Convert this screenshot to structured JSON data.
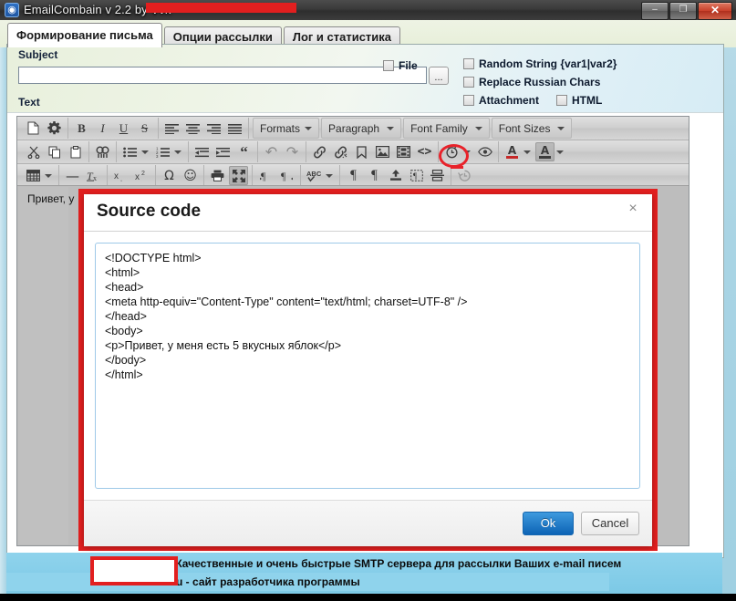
{
  "window": {
    "title": "EmailCombain v 2.2 by Vvk",
    "icon": "app-globe-icon",
    "minimize": "–",
    "maximize": "❐",
    "close": "✕"
  },
  "tabs": [
    {
      "label": "Формирование письма",
      "active": true
    },
    {
      "label": "Опции рассылки",
      "active": false
    },
    {
      "label": "Лог и статистика",
      "active": false
    }
  ],
  "form": {
    "subject_label": "Subject",
    "subject_value": "",
    "subject_placeholder": "",
    "browse_label": "...",
    "text_label": "Text",
    "checkboxes": {
      "file": "File",
      "random_string": "Random String {var1|var2}",
      "replace_russian": "Replace Russian Chars",
      "attachment": "Attachment",
      "html": "HTML"
    }
  },
  "toolbar": {
    "row1": {
      "new_document": "⬚",
      "settings": "⚙",
      "bold": "B",
      "italic": "I",
      "underline": "U",
      "strikethrough": "S",
      "align_left": "align-left",
      "align_center": "align-center",
      "align_right": "align-right",
      "align_justify": "align-justify",
      "formats": "Formats",
      "paragraph": "Paragraph",
      "font_family": "Font Family",
      "font_sizes": "Font Sizes"
    },
    "row2": {
      "cut": "✂",
      "copy": "copy",
      "paste": "paste",
      "find_replace": "find",
      "bullist": "bullist",
      "numlist": "numlist",
      "outdent": "outdent",
      "indent": "indent",
      "blockquote": "“",
      "undo": "↶",
      "redo": "↷",
      "link": "link",
      "unlink": "unlink",
      "anchor": "anchor",
      "image": "image",
      "media": "media",
      "source_code": "<>",
      "insert_datetime": "clock",
      "preview": "eye",
      "text_color": "A",
      "background_color": "A"
    },
    "row3": {
      "table": "table",
      "horizontal_rule": "—",
      "remove_format": "Tx",
      "subscript": "x₂",
      "superscript": "x²",
      "special_char": "Ω",
      "emoticons": "☺",
      "print": "print",
      "fullscreen": "fullscreen",
      "ltr": "ltr",
      "rtl": "rtl",
      "spellcheck": "ABC",
      "show_blocks": "¶",
      "visual_blocks": "¶",
      "insert_file": "upload",
      "visual_chars": "visualchars",
      "page_break": "pagebreak",
      "restore_draft": "restoredraft"
    }
  },
  "editor": {
    "visible_text": "Привет, у"
  },
  "dialog": {
    "title": "Source code",
    "close": "×",
    "code": "<!DOCTYPE html>\n<html>\n<head>\n<meta http-equiv=\"Content-Type\" content=\"text/html; charset=UTF-8\" />\n</head>\n<body>\n<p>Привет, у меня есть 5 вкусных яблок</p>\n</body>\n</html>",
    "ok_label": "Ok",
    "cancel_label": "Cancel"
  },
  "info": {
    "line1": "- Качественные и очень быстрые SMTP сервера для рассылки Ваших e-mail писем",
    "line2": "u - сайт разработчика программы"
  },
  "colors": {
    "accent_red": "#e21f1f",
    "ok_blue": "#0d63b5",
    "infobar_blue": "#8fd3ec",
    "toolbar_gray": "#cfcfcf"
  }
}
